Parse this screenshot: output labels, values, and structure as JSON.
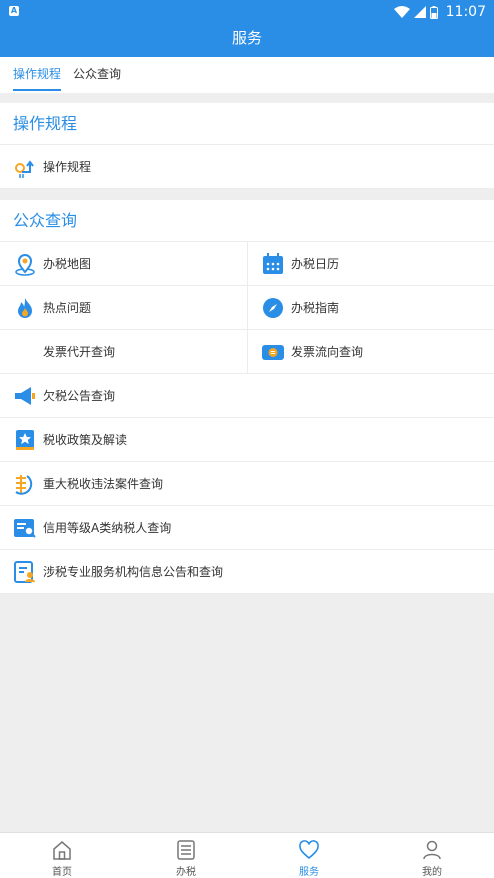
{
  "status": {
    "notif": "A",
    "time": "11:07"
  },
  "appbar": {
    "title": "服务"
  },
  "tabs": [
    {
      "label": "操作规程"
    },
    {
      "label": "公众查询"
    }
  ],
  "section1": {
    "title": "操作规程",
    "items": [
      {
        "label": "操作规程",
        "icon": "procedure-icon"
      }
    ]
  },
  "section2": {
    "title": "公众查询",
    "grid": [
      {
        "label": "办税地图",
        "icon": "map-pin-icon"
      },
      {
        "label": "办税日历",
        "icon": "calendar-icon"
      },
      {
        "label": "热点问题",
        "icon": "flame-icon"
      },
      {
        "label": "办税指南",
        "icon": "compass-icon"
      },
      {
        "label": "发票代开查询",
        "icon": ""
      },
      {
        "label": "发票流向查询",
        "icon": "invoice-flow-icon"
      }
    ],
    "list": [
      {
        "label": "欠税公告查询",
        "icon": "megaphone-icon"
      },
      {
        "label": "税收政策及解读",
        "icon": "policy-book-icon"
      },
      {
        "label": "重大税收违法案件查询",
        "icon": "tax-violation-icon"
      },
      {
        "label": "信用等级A类纳税人查询",
        "icon": "credit-card-search-icon"
      },
      {
        "label": "涉税专业服务机构信息公告和查询",
        "icon": "agency-doc-icon"
      }
    ]
  },
  "bottomnav": [
    {
      "label": "首页",
      "icon": "home-icon"
    },
    {
      "label": "办税",
      "icon": "list-icon"
    },
    {
      "label": "服务",
      "icon": "heart-icon"
    },
    {
      "label": "我的",
      "icon": "user-icon"
    }
  ],
  "colors": {
    "primary": "#2a8ee6",
    "accent_orange": "#f5a623",
    "background": "#eeeeee"
  }
}
